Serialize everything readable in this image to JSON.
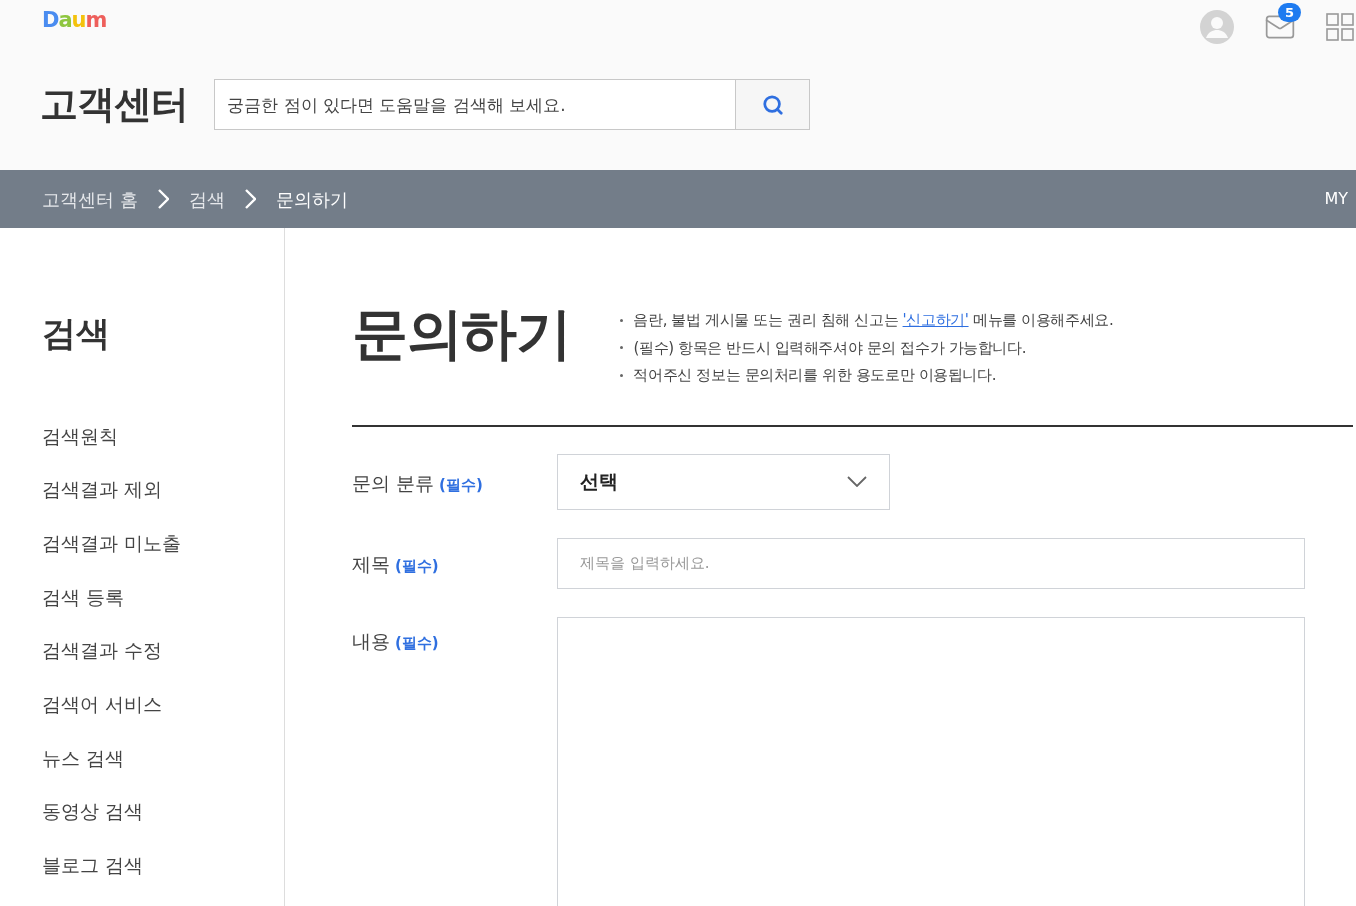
{
  "header": {
    "logo": "Daum",
    "title": "고객센터",
    "search": {
      "placeholder": "궁금한 점이 있다면 도움말을 검색해 보세요."
    },
    "mail_badge": "5"
  },
  "breadcrumb": {
    "items": [
      "고객센터 홈",
      "검색",
      "문의하기"
    ],
    "my": "MY"
  },
  "sidebar": {
    "title": "검색",
    "items": [
      {
        "label": "검색원칙"
      },
      {
        "label": "검색결과 제외"
      },
      {
        "label": "검색결과 미노출"
      },
      {
        "label": "검색 등록"
      },
      {
        "label": "검색결과 수정"
      },
      {
        "label": "검색어 서비스"
      },
      {
        "label": "뉴스 검색"
      },
      {
        "label": "동영상 검색"
      },
      {
        "label": "블로그 검색"
      }
    ]
  },
  "page": {
    "title": "문의하기",
    "notices": [
      {
        "before": "음란, 불법 게시물 또는 권리 침해 신고는 ",
        "link": "'신고하기'",
        "after": " 메뉴를 이용해주세요."
      },
      {
        "before": "(필수) 항목은 반드시 입력해주셔야 문의 접수가 가능합니다."
      },
      {
        "before": "적어주신 정보는 문의처리를 위한 용도로만 이용됩니다."
      }
    ]
  },
  "form": {
    "fields": [
      {
        "kind": "select",
        "label": "문의 분류",
        "required": "(필수)",
        "value": "선택"
      },
      {
        "kind": "text",
        "label": "제목",
        "required": "(필수)",
        "placeholder": "제목을 입력하세요."
      },
      {
        "kind": "textarea",
        "label": "내용",
        "required": "(필수)"
      }
    ]
  }
}
